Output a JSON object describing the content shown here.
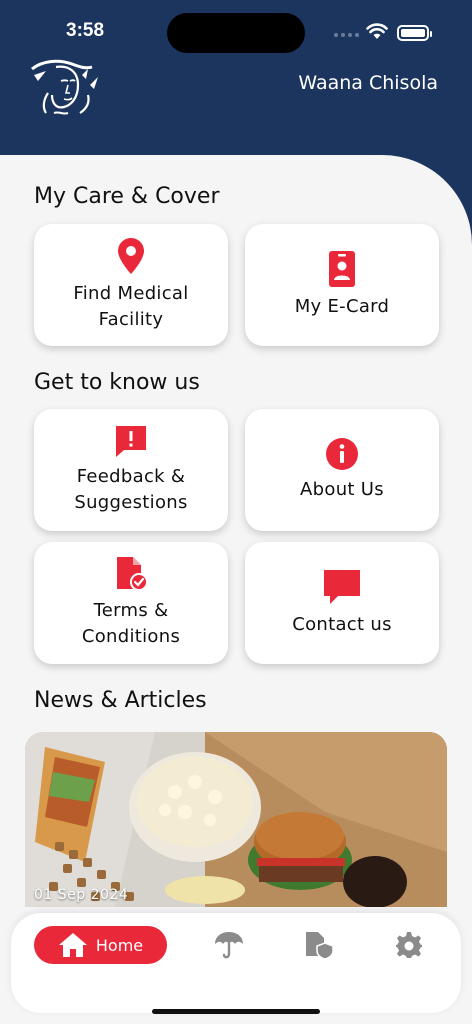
{
  "status": {
    "time": "3:58"
  },
  "header": {
    "user_name": "Waana Chisola",
    "logo_icon": "brand-logo-face"
  },
  "care": {
    "title": "My Care & Cover",
    "items": [
      {
        "label_line1": "Find Medical",
        "label_line2": "Facility",
        "icon": "location-pin-icon"
      },
      {
        "label_line1": "My E-Card",
        "label_line2": "",
        "icon": "id-card-icon"
      }
    ]
  },
  "about": {
    "title": "Get to know us",
    "items": [
      {
        "label_line1": "Feedback &",
        "label_line2": "Suggestions",
        "icon": "feedback-icon"
      },
      {
        "label_line1": "About Us",
        "label_line2": "",
        "icon": "info-icon"
      },
      {
        "label_line1": "Terms &",
        "label_line2": "Conditions",
        "icon": "document-check-icon"
      },
      {
        "label_line1": "Contact us",
        "label_line2": "",
        "icon": "chat-icon"
      }
    ]
  },
  "news": {
    "title": "News & Articles",
    "date": "01 Sep 2024"
  },
  "tabbar": {
    "home_label": "Home",
    "accent": "#e9283a"
  },
  "colors": {
    "header": "#1c355e",
    "accent": "#e9283a",
    "background": "#f5f5f6"
  }
}
